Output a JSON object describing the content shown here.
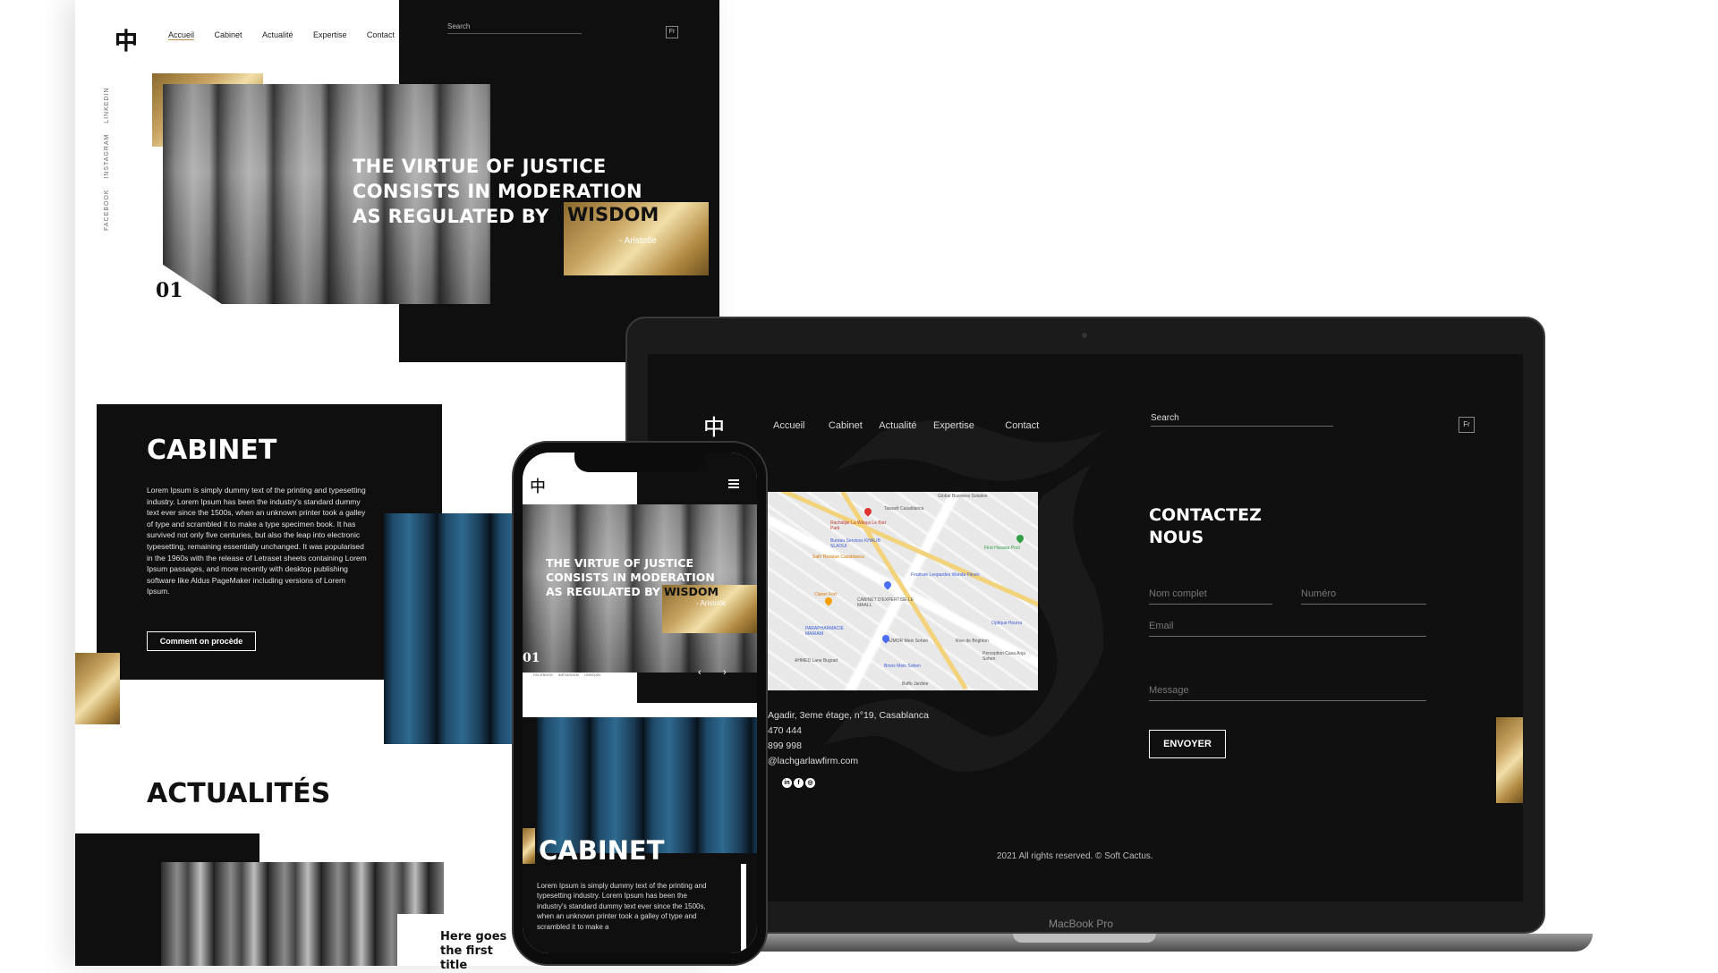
{
  "desktop": {
    "nav": [
      "Accueil",
      "Cabinet",
      "Actualité",
      "Expertise",
      "Contact"
    ],
    "search_placeholder": "Search",
    "lang": "Fr",
    "socials": [
      "FACEBOOK",
      "INSTAGRAM",
      "LINKEDIN"
    ],
    "hero": {
      "line1": "THE VIRTUE OF JUSTICE",
      "line2": "CONSISTS IN MODERATION",
      "line3": "AS REGULATED BY",
      "highlight": "WISDOM",
      "author": "- Aristotle",
      "slide_number": "01"
    },
    "cabinet": {
      "title": "CABINET",
      "body": "Lorem Ipsum is simply dummy text of the printing and typesetting industry. Lorem Ipsum has been the industry's standard dummy text ever since the 1500s, when an unknown printer took a galley of type and scrambled it to make a type specimen book. It has survived not only five centuries, but also the leap into electronic typesetting, remaining essentially unchanged. It was popularised in the 1960s with the release of Letraset sheets containing Lorem Ipsum passages, and more recently with desktop publishing software like Aldus PageMaker including versions of Lorem Ipsum.",
      "button": "Comment on procède"
    },
    "news": {
      "title": "ACTUALITÉS",
      "card_title": "Here goes the first title"
    }
  },
  "laptop": {
    "nav": [
      "Accueil",
      "Cabinet",
      "Actualité",
      "Expertise",
      "Contact"
    ],
    "search_placeholder": "Search",
    "lang": "Fr",
    "contact_title_1": "CONTACTEZ",
    "contact_title_2": "NOUS",
    "fields": {
      "name": "Nom complet",
      "phone": "Numéro",
      "email": "Email",
      "message": "Message"
    },
    "submit": "ENVOYER",
    "address": "Agadir, 3eme étage, n°19, Casablanca",
    "phone1": "470 444",
    "phone2": "899 998",
    "email": "@lachgarlawfirm.com",
    "footer": "2021 All rights reserved. © Soft Cactus.",
    "brand": "MacBook Pro",
    "map_labels": [
      "Global Business Solution",
      "Tawazit Casablanca",
      "Rachidijie La Wilaya Le Biat Park",
      "Bureau Services KHALIB SLAOUI",
      "Safir Rwaque Casablanca",
      "First Havana Pool",
      "Fourrure Leopardes Wanda Fleurs",
      "CABINET D'EXPERTISE LE MAALL",
      "Claner Fort",
      "PARAPHARMACIE MARIAM",
      "Optique Hourra",
      "HAJMOR Mein Sohen",
      "Rive de Brighton",
      "AHMED Lane Bugrad",
      "Bmos Mein Sohen",
      "Perception Casa Anja Sohen",
      "Buffo Jardine"
    ]
  },
  "phone": {
    "hero": {
      "line1": "THE VIRTUE OF JUSTICE",
      "line2": "CONSISTS IN MODERATION",
      "line3": "AS REGULATED BY",
      "highlight": "WISDOM",
      "author": "- Aristotle",
      "slide_number": "01"
    },
    "socials": [
      "FACEBOOK",
      "INSTAGRAM",
      "LINKEDIN"
    ],
    "cabinet_title": "CABINET",
    "cabinet_body": "Lorem Ipsum is simply dummy text of the printing and typesetting industry. Lorem Ipsum has been the industry's standard dummy text ever since the 1500s, when an unknown printer took a galley of type and scrambled it to make a"
  }
}
